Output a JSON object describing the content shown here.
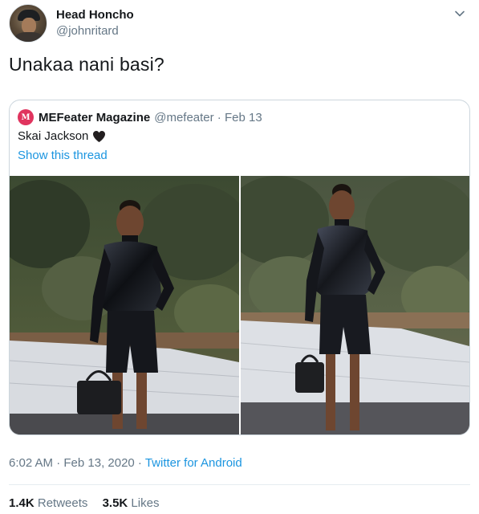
{
  "author": {
    "display_name": "Head Honcho",
    "handle": "@johnritard"
  },
  "tweet": {
    "text": "Unakaa nani basi?"
  },
  "quoted_tweet": {
    "avatar_text": "M",
    "display_name": "MEFeater Magazine",
    "handle_date": "@mefeater · Feb 13",
    "text": "Skai Jackson",
    "emoji": "black-heart",
    "show_thread": "Show this thread"
  },
  "meta": {
    "time_date": "6:02 AM · Feb 13, 2020 · ",
    "source": "Twitter for Android"
  },
  "stats": {
    "retweets_count": "1.4K",
    "retweets_label": "Retweets",
    "likes_count": "3.5K",
    "likes_label": "Likes"
  },
  "colors": {
    "link": "#1b95e0",
    "muted": "#657786",
    "text": "#14171a",
    "border": "#ccd6dd"
  },
  "icons": {
    "chevron": "chevron-down-icon"
  }
}
